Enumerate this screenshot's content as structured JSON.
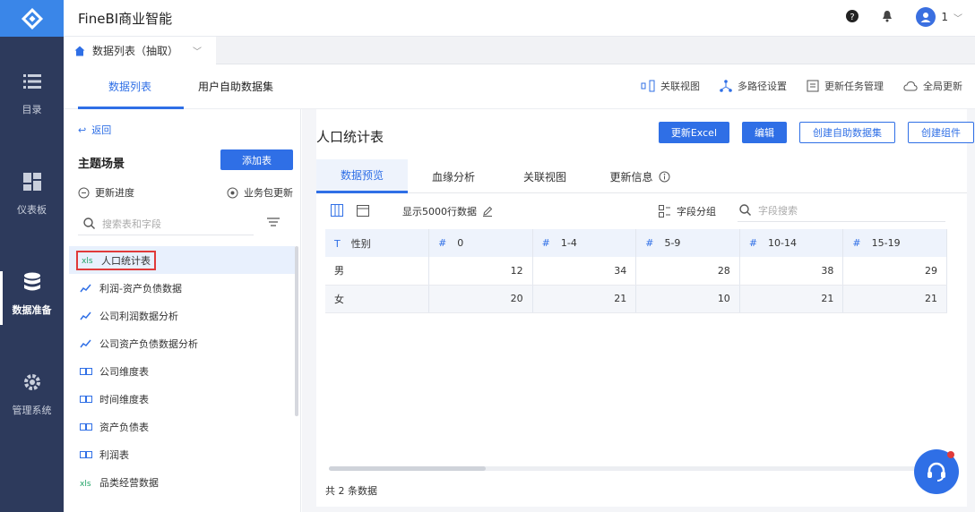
{
  "app": {
    "title": "FineBI商业智能"
  },
  "rail": {
    "items": [
      {
        "label": "目录",
        "icon": "list-icon"
      },
      {
        "label": "仪表板",
        "icon": "dashboard-icon"
      },
      {
        "label": "数据准备",
        "icon": "database-icon"
      },
      {
        "label": "管理系统",
        "icon": "gear-icon"
      }
    ]
  },
  "header": {
    "user": "1"
  },
  "doc_tab": {
    "label": "数据列表（抽取）"
  },
  "subnav": {
    "tabs": [
      "数据列表",
      "用户自助数据集"
    ],
    "actions": [
      "关联视图",
      "多路径设置",
      "更新任务管理",
      "全局更新"
    ]
  },
  "left": {
    "back": "返回",
    "scene_title": "主题场景",
    "add_button": "添加表",
    "progress": "更新进度",
    "business_update": "业务包更新",
    "search_placeholder": "搜索表和字段",
    "tree": [
      {
        "label": "人口统计表",
        "type": "excel",
        "selected": true
      },
      {
        "label": "利润-资产负债数据",
        "type": "self"
      },
      {
        "label": "公司利润数据分析",
        "type": "self"
      },
      {
        "label": "公司资产负债数据分析",
        "type": "self"
      },
      {
        "label": "公司维度表",
        "type": "db"
      },
      {
        "label": "时间维度表",
        "type": "db"
      },
      {
        "label": "资产负债表",
        "type": "db"
      },
      {
        "label": "利润表",
        "type": "db"
      },
      {
        "label": "品类经营数据",
        "type": "excel"
      }
    ]
  },
  "right": {
    "title": "人口统计表",
    "buttons": [
      "更新Excel",
      "编辑",
      "创建自助数据集",
      "创建组件"
    ],
    "tabs": [
      "数据预览",
      "血缘分析",
      "关联视图",
      "更新信息"
    ],
    "show_rows": "显示5000行数据",
    "field_group": "字段分组",
    "field_search_placeholder": "字段搜索",
    "columns": [
      {
        "type": "T",
        "label": "性别"
      },
      {
        "type": "#",
        "label": "0"
      },
      {
        "type": "#",
        "label": "1-4"
      },
      {
        "type": "#",
        "label": "5-9"
      },
      {
        "type": "#",
        "label": "10-14"
      },
      {
        "type": "#",
        "label": "15-19"
      }
    ],
    "rows": [
      [
        "男",
        "12",
        "34",
        "28",
        "38",
        "29"
      ],
      [
        "女",
        "20",
        "21",
        "10",
        "21",
        "21"
      ]
    ],
    "total": "共 2 条数据"
  },
  "colors": {
    "accent": "#2f6fe6",
    "rail": "#2d3a5c",
    "logo": "#3a86e8",
    "highlight_border": "#e03a3a"
  }
}
